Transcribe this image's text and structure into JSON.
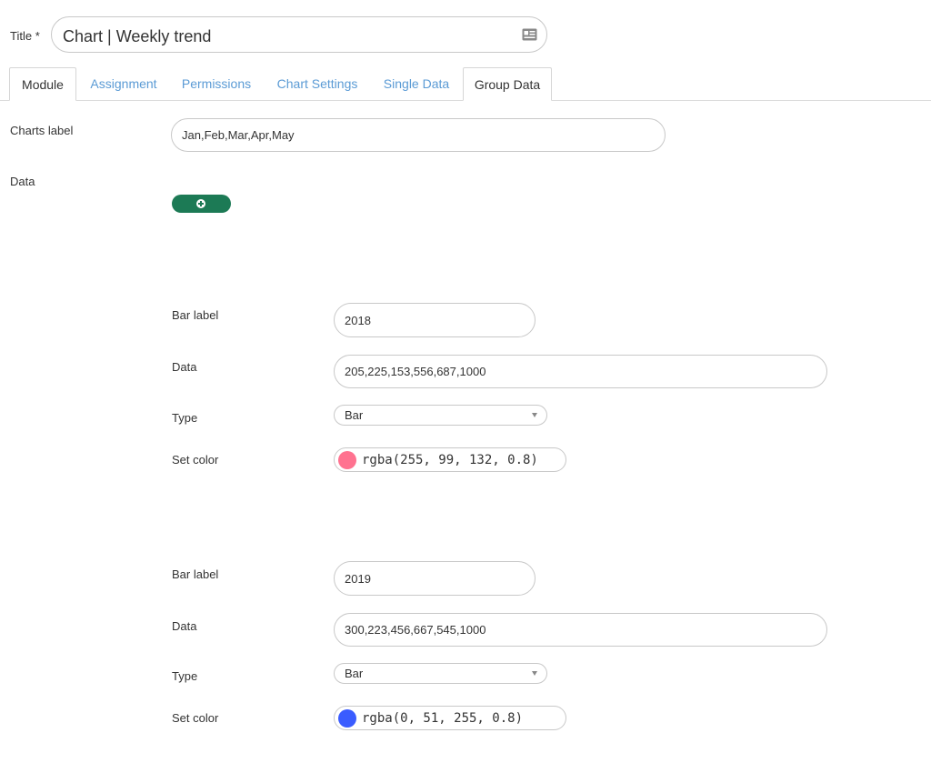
{
  "title": {
    "label": "Title *",
    "value": "Chart | Weekly trend"
  },
  "tabs": [
    {
      "label": "Module",
      "active": true
    },
    {
      "label": "Assignment",
      "active": false
    },
    {
      "label": "Permissions",
      "active": false
    },
    {
      "label": "Chart Settings",
      "active": false
    },
    {
      "label": "Single Data",
      "active": false
    },
    {
      "label": "Group Data",
      "active": true
    }
  ],
  "charts_label": {
    "label": "Charts label",
    "value": "Jan,Feb,Mar,Apr,May"
  },
  "data_section": {
    "label": "Data",
    "add_icon": "plus-circle-icon"
  },
  "datasets": [
    {
      "bar_label_label": "Bar label",
      "bar_label": "2018",
      "data_label": "Data",
      "data": "205,225,153,556,687,1000",
      "type_label": "Type",
      "type": "Bar",
      "color_label": "Set color",
      "color": "rgba(255, 99, 132, 0.8)",
      "swatch": "#ff7290"
    },
    {
      "bar_label_label": "Bar label",
      "bar_label": "2019",
      "data_label": "Data",
      "data": "300,223,456,667,545,1000",
      "type_label": "Type",
      "type": "Bar",
      "color_label": "Set color",
      "color": "rgba(0, 51, 255, 0.8)",
      "swatch": "#3a5cff"
    }
  ],
  "colors": {
    "accent_green": "#1c7a55",
    "tab_link": "#5b9bd5"
  }
}
